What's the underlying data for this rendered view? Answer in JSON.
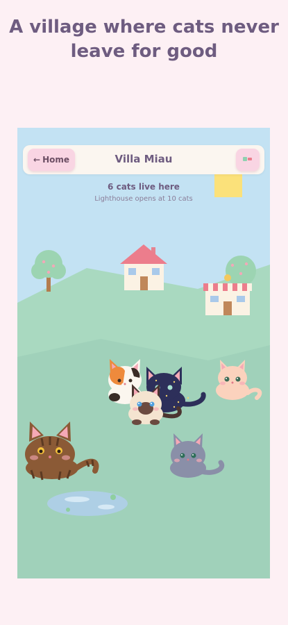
{
  "headline": "A village where cats never leave for good",
  "topbar": {
    "home_label": "Home",
    "home_icon": "arrow-left-icon",
    "title": "Villa Miau",
    "menu_icon": "cards-menu-icon"
  },
  "status": {
    "cat_count": "6 cats live here",
    "milestone": "Lighthouse opens at 10 cats"
  },
  "cats": [
    "calico",
    "starry-black",
    "siamese",
    "peach",
    "tabby-brown",
    "gray"
  ],
  "colors": {
    "sky": "#c3e2f3",
    "hills": "#a6d8be",
    "meadow": "#a0d1ba",
    "accent_pink": "#f9d5e3",
    "title_purple": "#6e5c80"
  }
}
